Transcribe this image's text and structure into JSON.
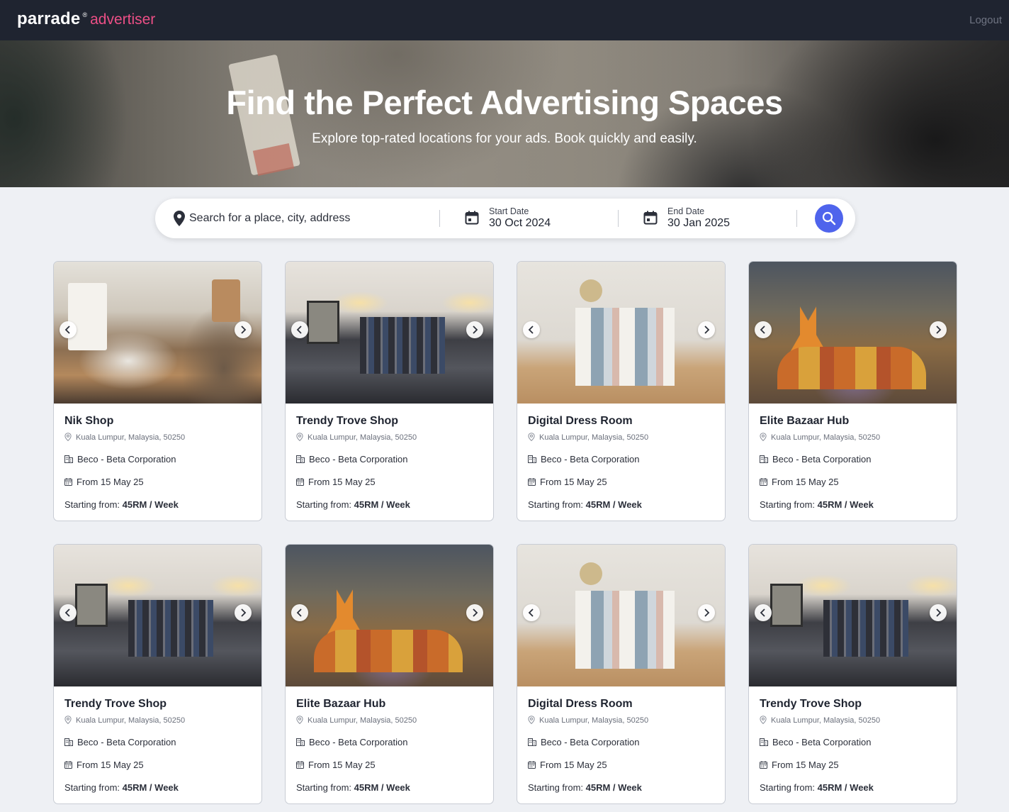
{
  "nav": {
    "brand_name": "parrade",
    "brand_mark": "®",
    "brand_sub": "advertiser",
    "logout_label": "Logout"
  },
  "hero": {
    "title": "Find the Perfect Advertising Spaces",
    "subtitle": "Explore top-rated locations for your ads. Book quickly and easily."
  },
  "search": {
    "placeholder": "Search for a place, city, address",
    "start_label": "Start Date",
    "start_value": "30 Oct 2024",
    "end_label": "End Date",
    "end_value": "30 Jan 2025",
    "icons": {
      "location": "map-pin-icon",
      "date": "calendar-icon",
      "submit": "search-icon"
    },
    "accent_color": "#4f64ec"
  },
  "price_prefix": "Starting from: ",
  "cards": [
    {
      "title": "Nik Shop",
      "location": "Kuala Lumpur, Malaysia, 50250",
      "company": "Beco - Beta Corporation",
      "date": "From 15 May 25",
      "price": "45RM / Week",
      "photo": "cafe-interior"
    },
    {
      "title": "Trendy Trove Shop",
      "location": "Kuala Lumpur, Malaysia, 50250",
      "company": "Beco - Beta Corporation",
      "date": "From 15 May 25",
      "price": "45RM / Week",
      "photo": "clothing-rack"
    },
    {
      "title": "Digital Dress Room",
      "location": "Kuala Lumpur, Malaysia, 50250",
      "company": "Beco - Beta Corporation",
      "date": "From 15 May 25",
      "price": "45RM / Week",
      "photo": "linen-display"
    },
    {
      "title": "Elite Bazaar Hub",
      "location": "Kuala Lumpur, Malaysia, 50250",
      "company": "Beco - Beta Corporation",
      "date": "From 15 May 25",
      "price": "45RM / Week",
      "photo": "spice-market"
    },
    {
      "title": "Trendy Trove Shop",
      "location": "Kuala Lumpur, Malaysia, 50250",
      "company": "Beco - Beta Corporation",
      "date": "From 15 May 25",
      "price": "45RM / Week",
      "photo": "clothing-rack"
    },
    {
      "title": "Elite Bazaar Hub",
      "location": "Kuala Lumpur, Malaysia, 50250",
      "company": "Beco - Beta Corporation",
      "date": "From 15 May 25",
      "price": "45RM / Week",
      "photo": "spice-market"
    },
    {
      "title": "Digital Dress Room",
      "location": "Kuala Lumpur, Malaysia, 50250",
      "company": "Beco - Beta Corporation",
      "date": "From 15 May 25",
      "price": "45RM / Week",
      "photo": "linen-display"
    },
    {
      "title": "Trendy Trove Shop",
      "location": "Kuala Lumpur, Malaysia, 50250",
      "company": "Beco - Beta Corporation",
      "date": "From 15 May 25",
      "price": "45RM / Week",
      "photo": "clothing-rack"
    }
  ]
}
